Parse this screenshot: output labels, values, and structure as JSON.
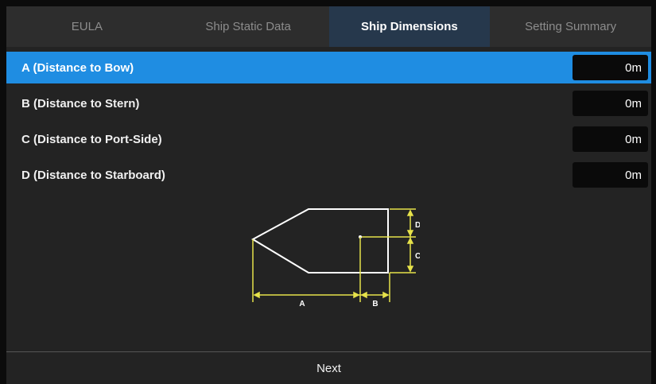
{
  "tabs": [
    {
      "label": "EULA",
      "active": false
    },
    {
      "label": "Ship Static Data",
      "active": false
    },
    {
      "label": "Ship Dimensions",
      "active": true
    },
    {
      "label": "Setting Summary",
      "active": false
    }
  ],
  "rows": [
    {
      "label": "A (Distance to Bow)",
      "value": "0",
      "unit": "m",
      "selected": true
    },
    {
      "label": "B (Distance to Stern)",
      "value": "0",
      "unit": "m",
      "selected": false
    },
    {
      "label": "C (Distance to Port-Side)",
      "value": "0",
      "unit": "m",
      "selected": false
    },
    {
      "label": "D (Distance to Starboard)",
      "value": "0",
      "unit": "m",
      "selected": false
    }
  ],
  "diagram": {
    "labels": {
      "a": "A",
      "b": "B",
      "c": "C",
      "d": "D"
    }
  },
  "footer": {
    "next_label": "Next"
  },
  "colors": {
    "accent": "#1f8de2",
    "dimension_lines": "#e6e24a",
    "ship_outline": "#ffffff"
  }
}
